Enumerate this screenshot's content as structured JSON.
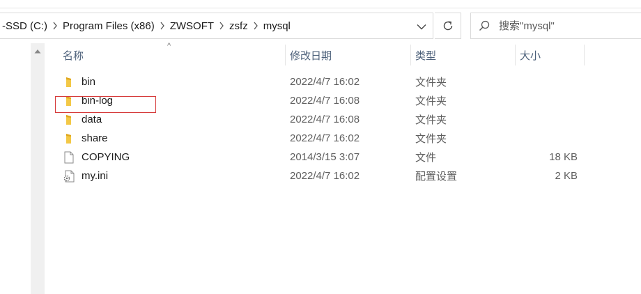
{
  "address": {
    "crumbs": [
      "-SSD (C:)",
      "Program Files (x86)",
      "ZWSOFT",
      "zsfz",
      "mysql"
    ]
  },
  "search": {
    "placeholder": "搜索\"mysql\""
  },
  "columns": {
    "name": "名称",
    "date": "修改日期",
    "type": "类型",
    "size": "大小"
  },
  "files": [
    {
      "name": "bin",
      "date": "2022/4/7 16:02",
      "type": "文件夹",
      "size": "",
      "icon": "folder-icon"
    },
    {
      "name": "bin-log",
      "date": "2022/4/7 16:08",
      "type": "文件夹",
      "size": "",
      "icon": "folder-icon"
    },
    {
      "name": "data",
      "date": "2022/4/7 16:08",
      "type": "文件夹",
      "size": "",
      "icon": "folder-icon"
    },
    {
      "name": "share",
      "date": "2022/4/7 16:02",
      "type": "文件夹",
      "size": "",
      "icon": "folder-icon"
    },
    {
      "name": "COPYING",
      "date": "2014/3/15 3:07",
      "type": "文件",
      "size": "18 KB",
      "icon": "file-icon"
    },
    {
      "name": "my.ini",
      "date": "2022/4/7 16:02",
      "type": "配置设置",
      "size": "2 KB",
      "icon": "config-file-icon"
    }
  ],
  "colors": {
    "folder": "#f3c846",
    "highlight_border": "#d63b3b",
    "header_text": "#4c607a"
  }
}
